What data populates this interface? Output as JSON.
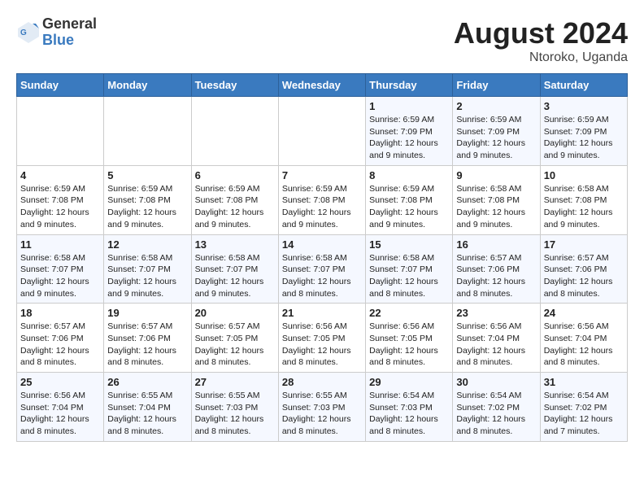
{
  "header": {
    "logo_general": "General",
    "logo_blue": "Blue",
    "month_year": "August 2024",
    "location": "Ntoroko, Uganda"
  },
  "weekdays": [
    "Sunday",
    "Monday",
    "Tuesday",
    "Wednesday",
    "Thursday",
    "Friday",
    "Saturday"
  ],
  "weeks": [
    [
      {
        "day": "",
        "info": ""
      },
      {
        "day": "",
        "info": ""
      },
      {
        "day": "",
        "info": ""
      },
      {
        "day": "",
        "info": ""
      },
      {
        "day": "1",
        "info": "Sunrise: 6:59 AM\nSunset: 7:09 PM\nDaylight: 12 hours\nand 9 minutes."
      },
      {
        "day": "2",
        "info": "Sunrise: 6:59 AM\nSunset: 7:09 PM\nDaylight: 12 hours\nand 9 minutes."
      },
      {
        "day": "3",
        "info": "Sunrise: 6:59 AM\nSunset: 7:09 PM\nDaylight: 12 hours\nand 9 minutes."
      }
    ],
    [
      {
        "day": "4",
        "info": "Sunrise: 6:59 AM\nSunset: 7:08 PM\nDaylight: 12 hours\nand 9 minutes."
      },
      {
        "day": "5",
        "info": "Sunrise: 6:59 AM\nSunset: 7:08 PM\nDaylight: 12 hours\nand 9 minutes."
      },
      {
        "day": "6",
        "info": "Sunrise: 6:59 AM\nSunset: 7:08 PM\nDaylight: 12 hours\nand 9 minutes."
      },
      {
        "day": "7",
        "info": "Sunrise: 6:59 AM\nSunset: 7:08 PM\nDaylight: 12 hours\nand 9 minutes."
      },
      {
        "day": "8",
        "info": "Sunrise: 6:59 AM\nSunset: 7:08 PM\nDaylight: 12 hours\nand 9 minutes."
      },
      {
        "day": "9",
        "info": "Sunrise: 6:58 AM\nSunset: 7:08 PM\nDaylight: 12 hours\nand 9 minutes."
      },
      {
        "day": "10",
        "info": "Sunrise: 6:58 AM\nSunset: 7:08 PM\nDaylight: 12 hours\nand 9 minutes."
      }
    ],
    [
      {
        "day": "11",
        "info": "Sunrise: 6:58 AM\nSunset: 7:07 PM\nDaylight: 12 hours\nand 9 minutes."
      },
      {
        "day": "12",
        "info": "Sunrise: 6:58 AM\nSunset: 7:07 PM\nDaylight: 12 hours\nand 9 minutes."
      },
      {
        "day": "13",
        "info": "Sunrise: 6:58 AM\nSunset: 7:07 PM\nDaylight: 12 hours\nand 9 minutes."
      },
      {
        "day": "14",
        "info": "Sunrise: 6:58 AM\nSunset: 7:07 PM\nDaylight: 12 hours\nand 8 minutes."
      },
      {
        "day": "15",
        "info": "Sunrise: 6:58 AM\nSunset: 7:07 PM\nDaylight: 12 hours\nand 8 minutes."
      },
      {
        "day": "16",
        "info": "Sunrise: 6:57 AM\nSunset: 7:06 PM\nDaylight: 12 hours\nand 8 minutes."
      },
      {
        "day": "17",
        "info": "Sunrise: 6:57 AM\nSunset: 7:06 PM\nDaylight: 12 hours\nand 8 minutes."
      }
    ],
    [
      {
        "day": "18",
        "info": "Sunrise: 6:57 AM\nSunset: 7:06 PM\nDaylight: 12 hours\nand 8 minutes."
      },
      {
        "day": "19",
        "info": "Sunrise: 6:57 AM\nSunset: 7:06 PM\nDaylight: 12 hours\nand 8 minutes."
      },
      {
        "day": "20",
        "info": "Sunrise: 6:57 AM\nSunset: 7:05 PM\nDaylight: 12 hours\nand 8 minutes."
      },
      {
        "day": "21",
        "info": "Sunrise: 6:56 AM\nSunset: 7:05 PM\nDaylight: 12 hours\nand 8 minutes."
      },
      {
        "day": "22",
        "info": "Sunrise: 6:56 AM\nSunset: 7:05 PM\nDaylight: 12 hours\nand 8 minutes."
      },
      {
        "day": "23",
        "info": "Sunrise: 6:56 AM\nSunset: 7:04 PM\nDaylight: 12 hours\nand 8 minutes."
      },
      {
        "day": "24",
        "info": "Sunrise: 6:56 AM\nSunset: 7:04 PM\nDaylight: 12 hours\nand 8 minutes."
      }
    ],
    [
      {
        "day": "25",
        "info": "Sunrise: 6:56 AM\nSunset: 7:04 PM\nDaylight: 12 hours\nand 8 minutes."
      },
      {
        "day": "26",
        "info": "Sunrise: 6:55 AM\nSunset: 7:04 PM\nDaylight: 12 hours\nand 8 minutes."
      },
      {
        "day": "27",
        "info": "Sunrise: 6:55 AM\nSunset: 7:03 PM\nDaylight: 12 hours\nand 8 minutes."
      },
      {
        "day": "28",
        "info": "Sunrise: 6:55 AM\nSunset: 7:03 PM\nDaylight: 12 hours\nand 8 minutes."
      },
      {
        "day": "29",
        "info": "Sunrise: 6:54 AM\nSunset: 7:03 PM\nDaylight: 12 hours\nand 8 minutes."
      },
      {
        "day": "30",
        "info": "Sunrise: 6:54 AM\nSunset: 7:02 PM\nDaylight: 12 hours\nand 8 minutes."
      },
      {
        "day": "31",
        "info": "Sunrise: 6:54 AM\nSunset: 7:02 PM\nDaylight: 12 hours\nand 7 minutes."
      }
    ]
  ]
}
